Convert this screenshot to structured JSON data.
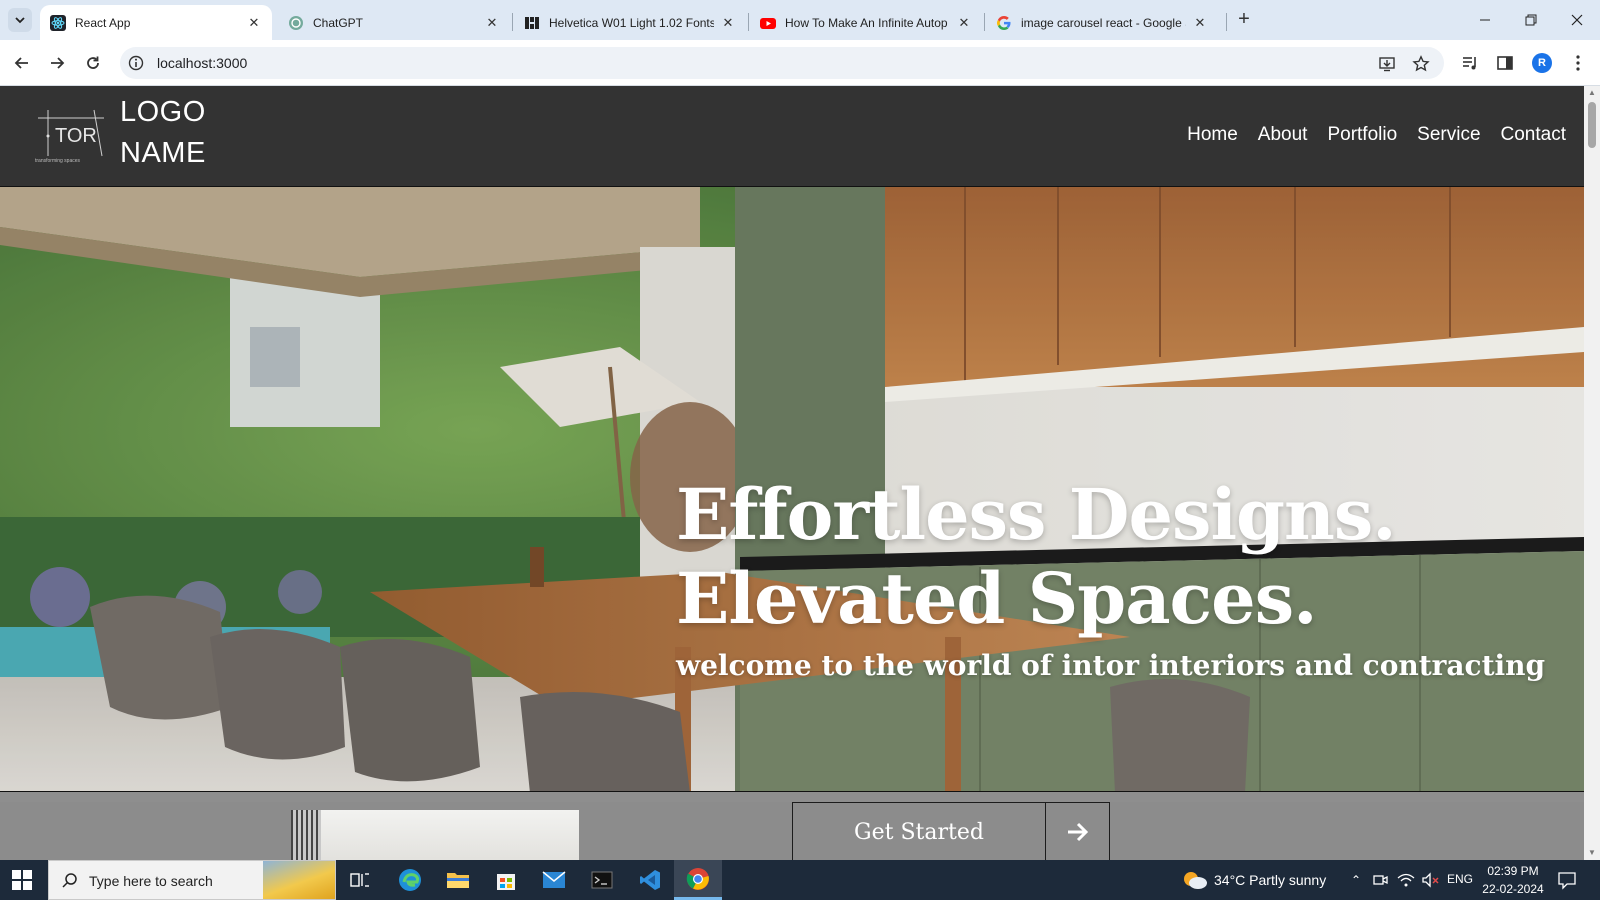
{
  "browser": {
    "tabs": [
      {
        "title": "React App",
        "icon": "react-icon",
        "active": true
      },
      {
        "title": "ChatGPT",
        "icon": "chatgpt-icon",
        "active": false
      },
      {
        "title": "Helvetica W01 Light 1.02 Fonts",
        "icon": "fonts-icon",
        "active": false
      },
      {
        "title": "How To Make An Infinite Autop",
        "icon": "youtube-icon",
        "active": false
      },
      {
        "title": "image carousel react - Google S",
        "icon": "google-icon",
        "active": false
      }
    ],
    "url": "localhost:3000",
    "profile_initial": "R"
  },
  "site": {
    "logo_mark_text": "TOR",
    "logo_tagline": "transforming spaces",
    "logo_line1": "LOGO",
    "logo_line2": "NAME",
    "nav": [
      "Home",
      "About",
      "Portfolio",
      "Service",
      "Contact"
    ],
    "hero": {
      "line1": "Effortless Designs.",
      "line2": "Elevated Spaces.",
      "subtitle": "welcome to the world of intor interiors and contracting"
    },
    "cta_label": "Get Started"
  },
  "taskbar": {
    "search_placeholder": "Type here to search",
    "weather": "34°C  Partly sunny",
    "language": "ENG",
    "time": "02:39 PM",
    "date": "22-02-2024"
  },
  "colors": {
    "header_bg": "#333333",
    "tabbar_bg": "#dee8f4",
    "taskbar_bg": "#1d2a3a",
    "accent": "#1a73e8"
  }
}
